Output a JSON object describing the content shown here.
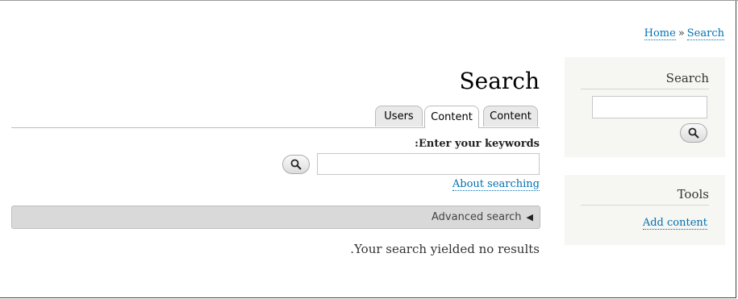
{
  "breadcrumb": {
    "home": "Home",
    "separator": "»",
    "current": "Search"
  },
  "main": {
    "title": "Search",
    "tabs": [
      {
        "label": "Users",
        "active": false
      },
      {
        "label": "Content",
        "active": true
      },
      {
        "label": "Content",
        "active": false
      }
    ],
    "keywords_label": ":Enter your keywords",
    "keywords_value": "",
    "about_link": "About searching",
    "advanced_label": "Advanced search",
    "advanced_arrow": "◀",
    "no_results": ".Your search yielded no results"
  },
  "sidebar": {
    "search_block": {
      "title": "Search",
      "input_value": ""
    },
    "tools_block": {
      "title": "Tools",
      "add_content": "Add content"
    }
  },
  "icons": {
    "search_button": "magnifier-icon",
    "advanced_toggle": "triangle-left-icon"
  },
  "colors": {
    "link": "#0071b3",
    "sidebar_bg": "#f6f6f2",
    "advanced_bg": "#d9d9d9"
  }
}
